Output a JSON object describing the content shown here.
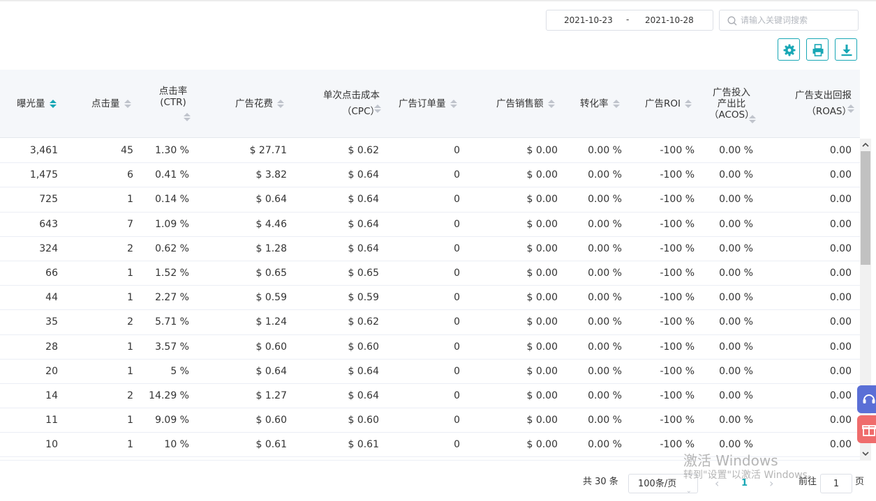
{
  "filters": {
    "date_start": "2021-10-23",
    "date_sep": "-",
    "date_end": "2021-10-28",
    "search_placeholder": "请输入关键词搜索"
  },
  "toolbar": {
    "settings_icon": "gear-icon",
    "print_icon": "print-icon",
    "download_icon": "download-icon",
    "accent": "#18a7b5"
  },
  "columns": [
    {
      "key": "impressions",
      "label": "曝光量",
      "sort": "active"
    },
    {
      "key": "clicks",
      "label": "点击量",
      "sort": "default"
    },
    {
      "key": "ctr",
      "label": "点击率(CTR)",
      "sort": "default"
    },
    {
      "key": "spend",
      "label": "广告花费",
      "sort": "default"
    },
    {
      "key": "cpc",
      "label": "单次点击成本（CPC）",
      "sort": "default"
    },
    {
      "key": "orders",
      "label": "广告订单量",
      "sort": "default"
    },
    {
      "key": "sales",
      "label": "广告销售额",
      "sort": "default"
    },
    {
      "key": "cvr",
      "label": "转化率",
      "sort": "default"
    },
    {
      "key": "roi",
      "label": "广告ROI",
      "sort": "default"
    },
    {
      "key": "acos",
      "label": "广告投入产出比（ACOS）",
      "sort": "default"
    },
    {
      "key": "roas",
      "label": "广告支出回报（ROAS）",
      "sort": "default"
    }
  ],
  "rows": [
    [
      "3,461",
      "45",
      "1.30 %",
      "$ 27.71",
      "$ 0.62",
      "0",
      "$ 0.00",
      "0.00 %",
      "-100 %",
      "0.00 %",
      "0.00"
    ],
    [
      "1,475",
      "6",
      "0.41 %",
      "$ 3.82",
      "$ 0.64",
      "0",
      "$ 0.00",
      "0.00 %",
      "-100 %",
      "0.00 %",
      "0.00"
    ],
    [
      "725",
      "1",
      "0.14 %",
      "$ 0.64",
      "$ 0.64",
      "0",
      "$ 0.00",
      "0.00 %",
      "-100 %",
      "0.00 %",
      "0.00"
    ],
    [
      "643",
      "7",
      "1.09 %",
      "$ 4.46",
      "$ 0.64",
      "0",
      "$ 0.00",
      "0.00 %",
      "-100 %",
      "0.00 %",
      "0.00"
    ],
    [
      "324",
      "2",
      "0.62 %",
      "$ 1.28",
      "$ 0.64",
      "0",
      "$ 0.00",
      "0.00 %",
      "-100 %",
      "0.00 %",
      "0.00"
    ],
    [
      "66",
      "1",
      "1.52 %",
      "$ 0.65",
      "$ 0.65",
      "0",
      "$ 0.00",
      "0.00 %",
      "-100 %",
      "0.00 %",
      "0.00"
    ],
    [
      "44",
      "1",
      "2.27 %",
      "$ 0.59",
      "$ 0.59",
      "0",
      "$ 0.00",
      "0.00 %",
      "-100 %",
      "0.00 %",
      "0.00"
    ],
    [
      "35",
      "2",
      "5.71 %",
      "$ 1.24",
      "$ 0.62",
      "0",
      "$ 0.00",
      "0.00 %",
      "-100 %",
      "0.00 %",
      "0.00"
    ],
    [
      "28",
      "1",
      "3.57 %",
      "$ 0.60",
      "$ 0.60",
      "0",
      "$ 0.00",
      "0.00 %",
      "-100 %",
      "0.00 %",
      "0.00"
    ],
    [
      "20",
      "1",
      "5 %",
      "$ 0.64",
      "$ 0.64",
      "0",
      "$ 0.00",
      "0.00 %",
      "-100 %",
      "0.00 %",
      "0.00"
    ],
    [
      "14",
      "2",
      "14.29 %",
      "$ 1.27",
      "$ 0.64",
      "0",
      "$ 0.00",
      "0.00 %",
      "-100 %",
      "0.00 %",
      "0.00"
    ],
    [
      "11",
      "1",
      "9.09 %",
      "$ 0.60",
      "$ 0.60",
      "0",
      "$ 0.00",
      "0.00 %",
      "-100 %",
      "0.00 %",
      "0.00"
    ],
    [
      "10",
      "1",
      "10 %",
      "$ 0.61",
      "$ 0.61",
      "0",
      "$ 0.00",
      "0.00 %",
      "-100 %",
      "0.00 %",
      "0.00"
    ]
  ],
  "pagination": {
    "total": "共 30 条",
    "page_size": "100条/页",
    "current_page": "1",
    "goto_label": "前往",
    "goto_value": "1",
    "page_suffix": "页"
  },
  "watermark": {
    "line1": "激活 Windows",
    "line2": "转到\"设置\"以激活 Windows。"
  }
}
